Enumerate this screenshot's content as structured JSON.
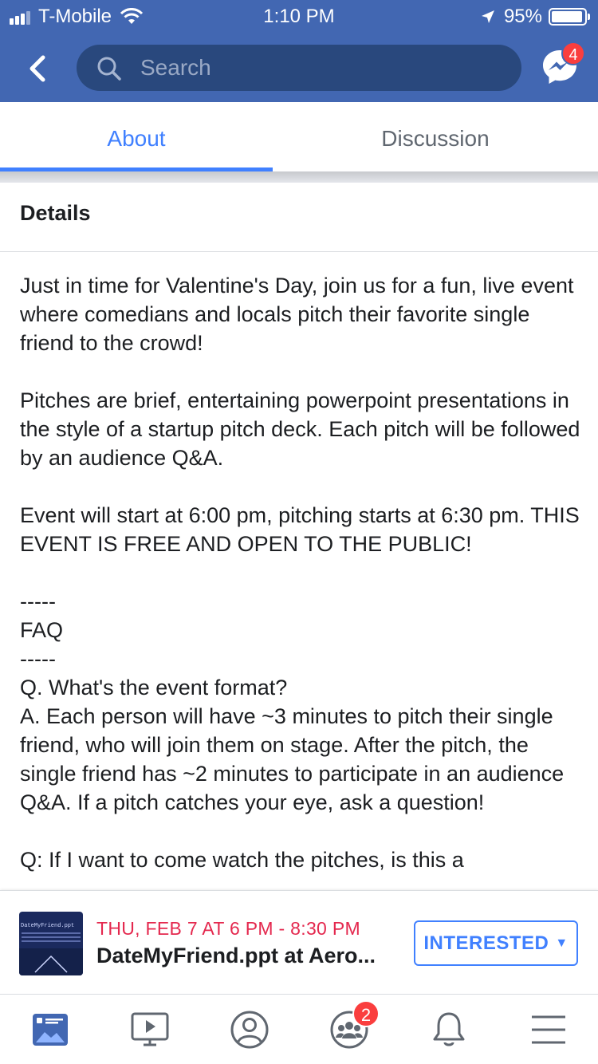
{
  "status_bar": {
    "carrier": "T-Mobile",
    "time": "1:10 PM",
    "battery": "95%",
    "battery_level": 0.95
  },
  "header": {
    "search_placeholder": "Search",
    "messenger_badge": "4"
  },
  "tabs": [
    {
      "label": "About",
      "active": true
    },
    {
      "label": "Discussion",
      "active": false
    }
  ],
  "details": {
    "title": "Details",
    "paragraphs": [
      "Just in time for Valentine's Day, join us for a fun, live event where comedians and locals pitch their favorite single friend to the crowd!",
      "Pitches are brief, entertaining powerpoint presentations in the style of a startup pitch deck. Each pitch will be followed by an audience Q&A.",
      "Event will start at 6:00 pm, pitching starts at 6:30 pm. THIS EVENT IS FREE AND OPEN TO THE PUBLIC!",
      "-----\nFAQ\n-----\nQ. What's the event format?\nA. Each person will have ~3 minutes to pitch their single friend, who will join them on stage. After the pitch, the single friend has ~2 minutes to participate in an audience Q&A. If a pitch catches your eye, ask a question!",
      "Q: If I want to come watch the pitches, is this a"
    ]
  },
  "event_bar": {
    "thumbnail_text": "DateMyFriend.ppt",
    "date": "THU, FEB 7 AT 6 PM - 8:30 PM",
    "title": "DateMyFriend.ppt at Aero...",
    "interested_label": "INTERESTED"
  },
  "bottom_nav": {
    "items": [
      "news-feed-icon",
      "watch-icon",
      "profile-icon",
      "groups-icon",
      "notifications-icon",
      "menu-icon"
    ],
    "groups_badge": "2"
  },
  "colors": {
    "brand": "#4267b2",
    "search_bg": "#29487d",
    "accent": "#4080ff",
    "badge": "#fa3e3e",
    "event_date": "#e4284e"
  }
}
